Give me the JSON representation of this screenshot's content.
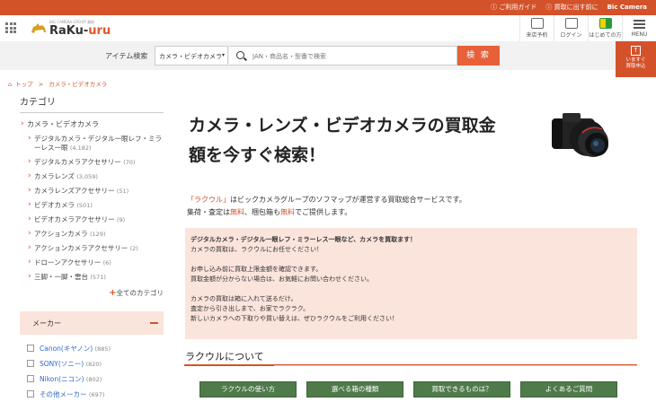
{
  "topbar": {
    "links": [
      "ご利用ガイド",
      "買取に出す前に"
    ],
    "brand": "Bic Camera"
  },
  "header": {
    "logo_tagline": "BIG CAMERA GROUP 買取",
    "logo_text_1": "RaKu-",
    "logo_text_2": "uru",
    "icons": [
      {
        "label": "来店予約",
        "icon": "calendar-icon"
      },
      {
        "label": "ログイン",
        "icon": "login-icon"
      },
      {
        "label": "はじめての方",
        "icon": "beginner-icon"
      },
      {
        "label": "MENU",
        "icon": "menu-icon"
      }
    ]
  },
  "search": {
    "label": "アイテム検索",
    "category": "カメラ・ビデオカメラ",
    "placeholder": "JAN・商品名・型番で検索",
    "button": "検 索"
  },
  "sell_box": {
    "line1": "いますぐ",
    "line2": "買取申込"
  },
  "breadcrumb": {
    "home": "トップ",
    "sep": ">",
    "current": "カメラ・ビデオカメラ"
  },
  "sidebar": {
    "heading": "カテゴリ",
    "top_item": "カメラ・ビデオカメラ",
    "items": [
      {
        "label": "デジタルカメラ・デジタル一眼レフ・ミラーレス一眼",
        "count": "(4,182)"
      },
      {
        "label": "デジタルカメラアクセサリー",
        "count": "(70)"
      },
      {
        "label": "カメラレンズ",
        "count": "(3,059)"
      },
      {
        "label": "カメラレンズアクセサリー",
        "count": "(51)"
      },
      {
        "label": "ビデオカメラ",
        "count": "(501)"
      },
      {
        "label": "ビデオカメラアクセサリー",
        "count": "(9)"
      },
      {
        "label": "アクションカメラ",
        "count": "(129)"
      },
      {
        "label": "アクションカメラアクセサリー",
        "count": "(2)"
      },
      {
        "label": "ドローンアクセサリー",
        "count": "(6)"
      },
      {
        "label": "三脚・一脚・雲台",
        "count": "(571)"
      }
    ],
    "all_link": "全てのカテゴリ",
    "maker_heading": "メーカー",
    "makers": [
      {
        "label": "Canon(キヤノン)",
        "count": "(885)"
      },
      {
        "label": "SONY(ソニー)",
        "count": "(820)"
      },
      {
        "label": "Nikon(ニコン)",
        "count": "(802)"
      },
      {
        "label": "その他メーカー",
        "count": "(697)"
      }
    ]
  },
  "main": {
    "title_line1": "カメラ・レンズ・ビデオカメラの買取金",
    "title_line2": "額を今すぐ検索！",
    "intro_brand": "「ラクウル」",
    "intro_line1_rest": "はビックカメラグループのソフマップが運営する買取総合サービスです。",
    "intro_line2_a": "集荷・査定は",
    "intro_free1": "無料",
    "intro_line2_b": "、梱包箱も",
    "intro_free2": "無料",
    "intro_line2_c": "でご提供します。",
    "notice": {
      "heading": "デジタルカメラ・デジタル一眼レフ・ミラーレス一眼など、カメラを買取ます！",
      "p1": "カメラの買取は、ラクウルにお任せください！",
      "p2": "お申し込み前に買取上限金額を確認できます。",
      "p3": "買取金額が分からない場合は、お気軽にお問い合わせください。",
      "p4": "カメラの買取は箱に入れて送るだけ。",
      "p5": "査定から引き出しまで、お家でラクラク。",
      "p6": "新しいカメラへの下取りや買い替えは、ぜひラクウルをご利用ください！"
    },
    "about_heading": "ラクウルについて",
    "tabs": [
      "ラクウルの使い方",
      "選べる箱の種類",
      "買取できるものは？",
      "よくあるご質問"
    ]
  },
  "colors": {
    "accent": "#d4522a",
    "tab_green": "#4f7a4a",
    "notice_bg": "#fbe4dc"
  }
}
